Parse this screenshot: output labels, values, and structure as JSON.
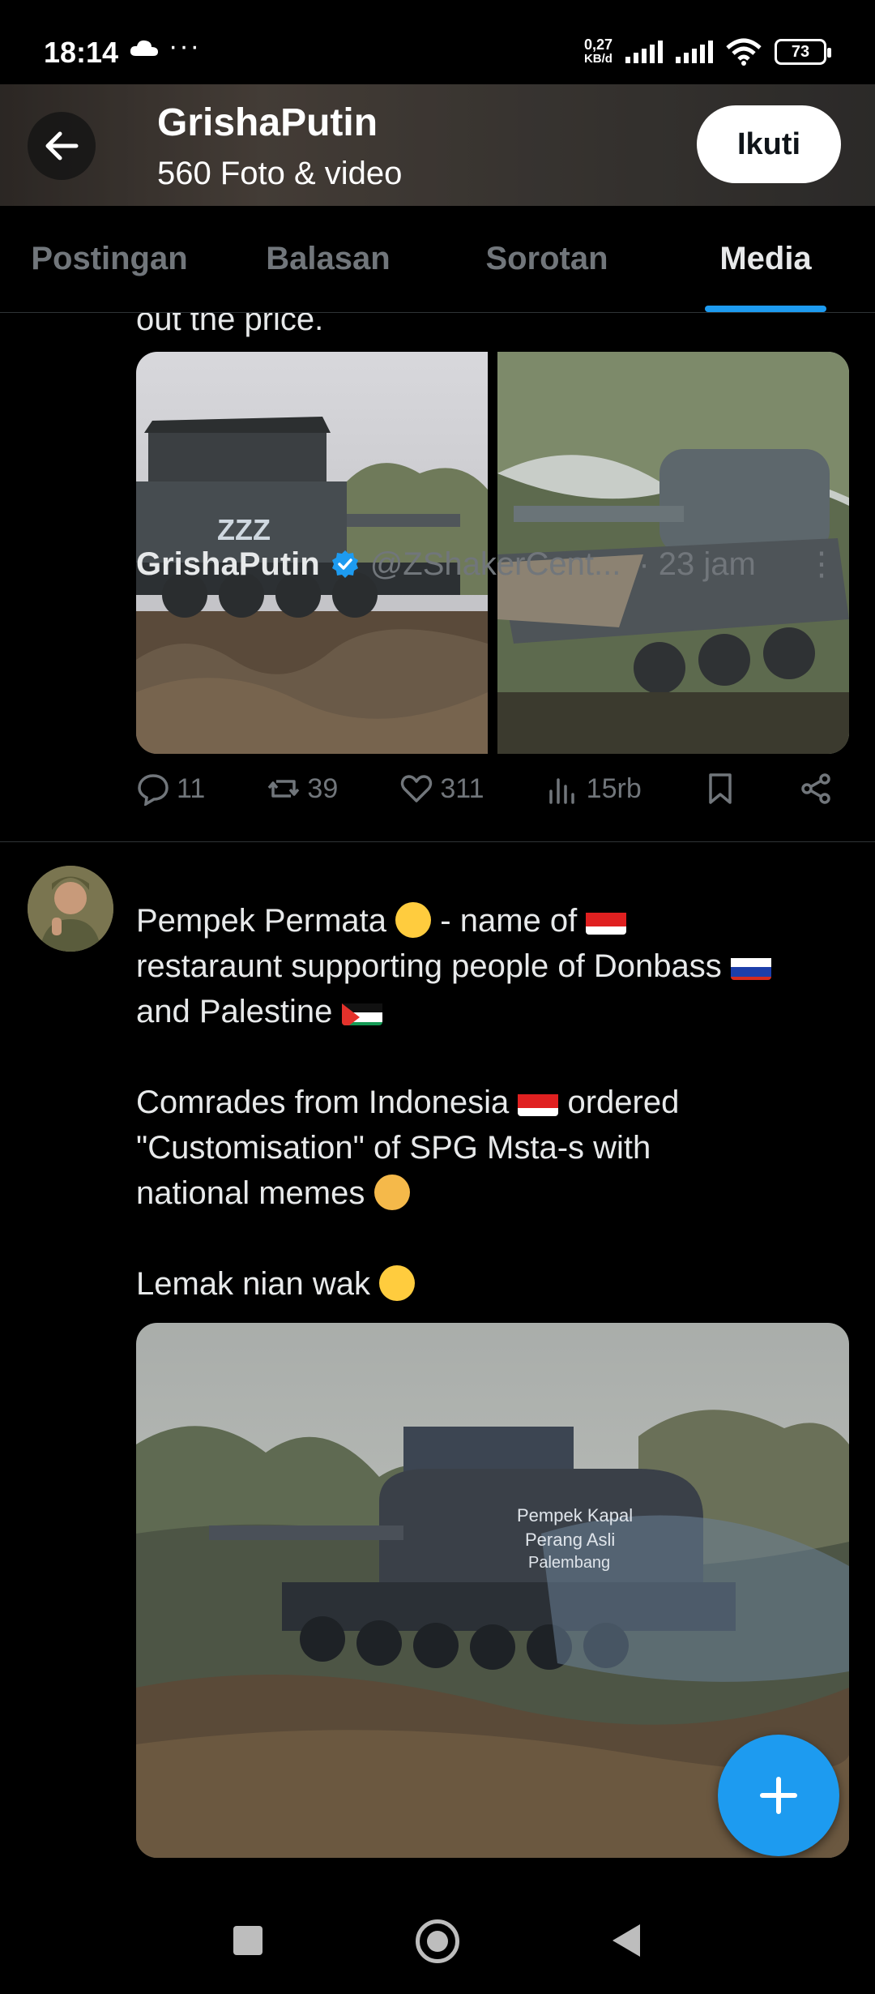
{
  "status_bar": {
    "time": "18:14",
    "net_speed_value": "0,27",
    "net_speed_unit": "KB/d",
    "battery": "73"
  },
  "header": {
    "profile_name": "GrishaPutin",
    "media_count": "560 Foto & video",
    "follow_label": "Ikuti"
  },
  "tabs": [
    {
      "label": "Postingan",
      "active": false
    },
    {
      "label": "Balasan",
      "active": false
    },
    {
      "label": "Sorotan",
      "active": false
    },
    {
      "label": "Media",
      "active": true
    }
  ],
  "post1": {
    "text_tail": "out the price.",
    "images": [
      "tank-zzz-photo",
      "tank-camouflage-photo"
    ],
    "stats": {
      "replies": "11",
      "reposts": "39",
      "likes": "311",
      "views": "15rb"
    }
  },
  "post2": {
    "name": "GrishaPutin",
    "handle": "@ZShakerCent...",
    "time": "· 23 jam",
    "line1a": "Pempek Permata",
    "line1b": " - name of ",
    "line2": "restaraunt supporting people of Donbass",
    "line3": "and Palestine",
    "para2_a": "Comrades from Indonesia",
    "para2_b": " ordered",
    "para2_c": "\"Customisation\" of SPG Msta-s with",
    "para2_d": "national memes",
    "para3": "Lemak nian wak",
    "image_caption": [
      "Pempek Kapal",
      "Perang Asli",
      "Palembang"
    ]
  },
  "colors": {
    "accent": "#1d9bf0",
    "muted": "#71767b",
    "text": "#e7e9ea",
    "background": "#000000"
  }
}
